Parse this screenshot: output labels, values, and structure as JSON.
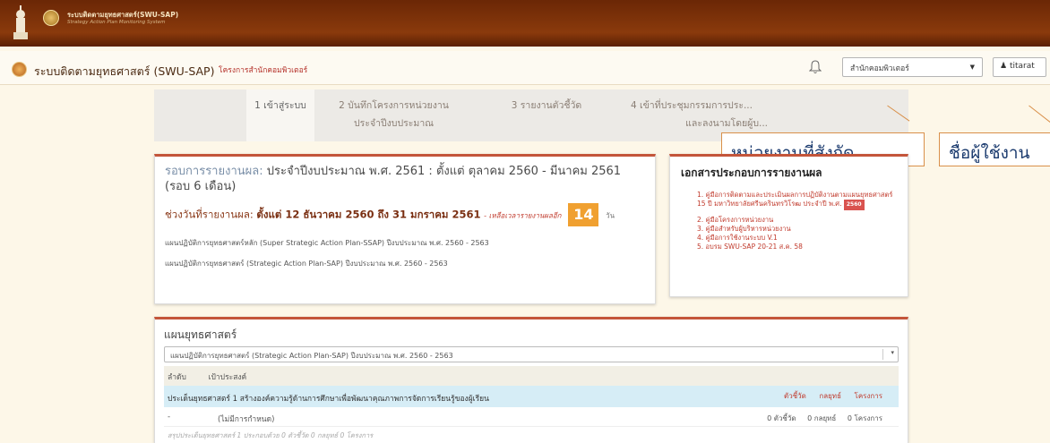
{
  "banner": {
    "title": "ระบบติดตามยุทธศาสตร์(SWU-SAP)",
    "subtitle": "Strategy Action Plan Monitoring System"
  },
  "navbar": {
    "title": "ระบบติดตามยุทธศาสตร์ (SWU-SAP)",
    "link": "โครงการสำนักคอมพิวเตอร์",
    "unit_value": "สำนักคอมพิวเตอร์",
    "user": "titarat"
  },
  "steps": [
    {
      "line1": "1 เข้าสู่ระบบ",
      "line2": ""
    },
    {
      "line1": "2 บันทึกโครงการหน่วยงาน",
      "line2": "ประจำปีงบประมาณ"
    },
    {
      "line1": "3 รายงานตัวชี้วัด",
      "line2": ""
    },
    {
      "line1": "4 เข้าที่ประชุมกรรมการประ...",
      "line2": "และลงนามโดยผู้บ..."
    }
  ],
  "callouts": {
    "unit": "หน่วยงานที่สังกัด",
    "user": "ชื่อผู้ใช้งาน"
  },
  "round": {
    "label": "รอบการรายงานผล:",
    "text": "ประจำปีงบประมาณ พ.ศ. 2561 : ตั้งแต่ ตุลาคม 2560 - มีนาคม 2561 (รอบ 6 เดือน)",
    "period_label": "ช่วงวันที่รายงานผล:",
    "period_dates": "ตั้งแต่ 12 ธันวาคม 2560 ถึง 31 มกราคม 2561",
    "remaining_text": "- เหลือเวลารายงานผลอีก",
    "days": "14",
    "days_unit": "วัน",
    "plan1": "แผนปฏิบัติการยุทธศาสตร์หลัก (Super Strategic Action Plan-SSAP) ปีงบประมาณ พ.ศ. 2560 - 2563",
    "plan2": "แผนปฏิบัติการยุทธศาสตร์ (Strategic Action Plan-SAP) ปีงบประมาณ พ.ศ. 2560 - 2563"
  },
  "docs": {
    "title": "เอกสารประกอบการรายงานผล",
    "item1": "1. คู่มือการติดตามและประเมินผลการปฏิบัติงานตามแผนยุทธศาสตร์ 15 ปี มหาวิทยาลัยศรีนครินทรวิโรฒ ประจำปี พ.ศ.",
    "item1_badge": "2560",
    "item2": "2. คู่มือโครงการหน่วยงาน",
    "item3": "3. คู่มือสำหรับผู้บริหารหน่วยงาน",
    "item4": "4. คู่มือการใช้งานระบบ V.1",
    "item5": "5. อบรม SWU-SAP 20-21 ส.ค. 58"
  },
  "strategy": {
    "title": "แผนยุทธศาสตร์",
    "select_value": "แผนปฏิบัติการยุทธศาสตร์ (Strategic Action Plan-SAP) ปีงบประมาณ พ.ศ. 2560 - 2563",
    "col_order": "ลำดับ",
    "col_goal": "เป้าประสงค์",
    "goal_row": "ประเด็นยุทธศาสตร์ 1 สร้างองค์ความรู้ด้านการศึกษาเพื่อพัฒนาคุณภาพการจัดการเรียนรู้ของผู้เรียน",
    "goal_cols": [
      "ตัวชี้วัด",
      "กลยุทธ์",
      "โครงการ"
    ],
    "row2_order": "-",
    "row2_text": "(ไม่มีการกำหนด)",
    "row2_counts": [
      "0 ตัวชี้วัด",
      "0 กลยุทธ์",
      "0 โครงการ"
    ],
    "summary": "สรุปประเด็นยุทธศาสตร์ 1 ประกอบด้วย 0 ตัวชี้วัด 0 กลยุทธ์ 0 โครงการ"
  }
}
